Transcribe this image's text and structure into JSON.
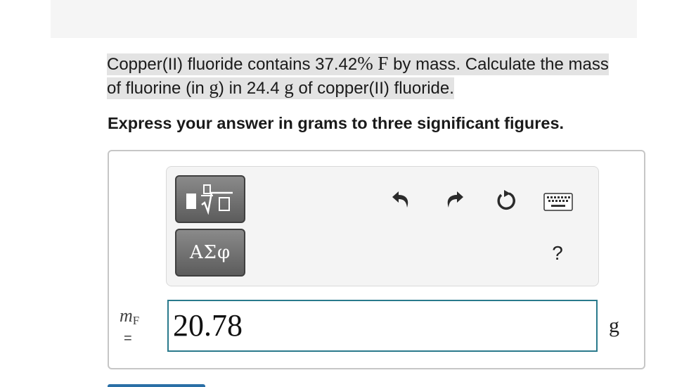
{
  "question": {
    "text_a": "Copper(II) fluoride contains 37.42",
    "percent": "%",
    "element": "F",
    "text_b": " by mass. Calculate the mass of fluorine (in ",
    "unit_in": "g",
    "text_c": ") in 24.4 ",
    "unit_mass": "g",
    "text_d": " of copper(II) fluoride."
  },
  "instruction": "Express your answer in grams to three significant figures.",
  "toolbar": {
    "symbols_label": "ΑΣφ",
    "help_label": "?"
  },
  "answer": {
    "variable": "m",
    "variable_sub": "F",
    "equals": "=",
    "value": "20.78",
    "unit": "g"
  },
  "colors": {
    "input_border": "#2a7a8c",
    "tool_button": "#6e6e6e",
    "highlight": "#e3e3e3"
  }
}
